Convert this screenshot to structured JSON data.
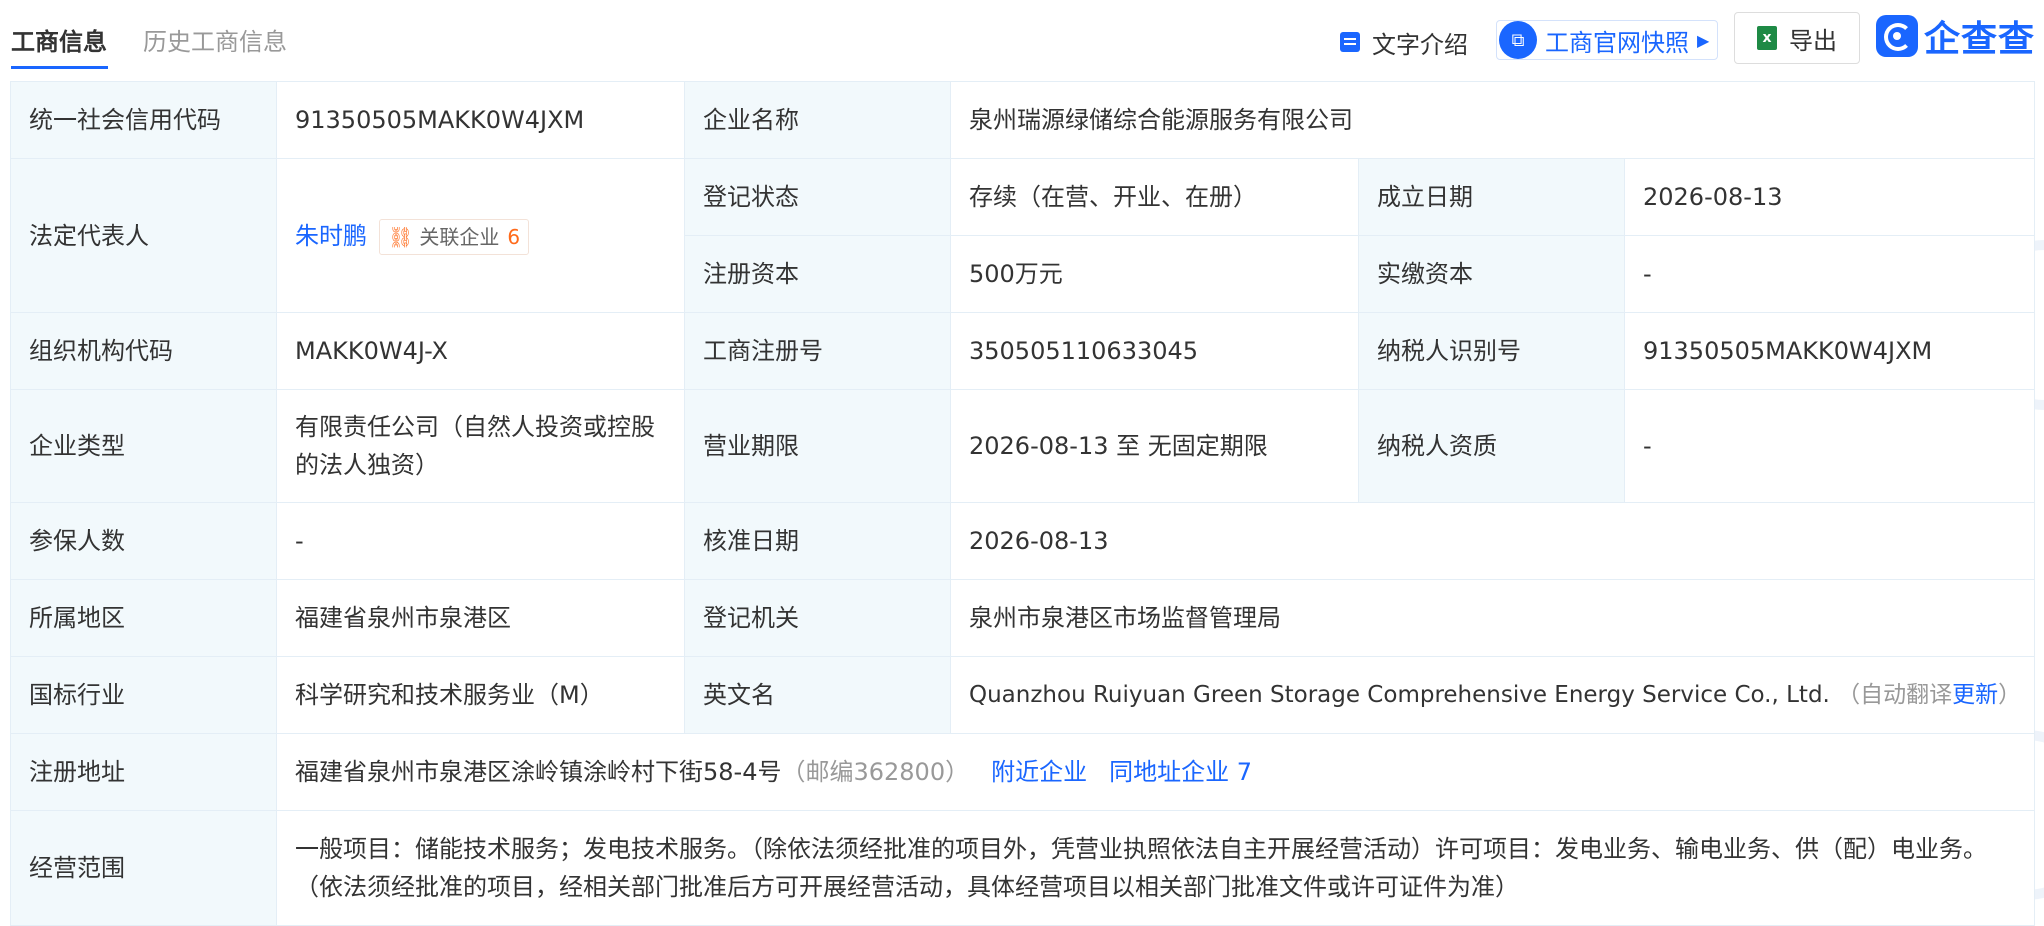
{
  "tabs": {
    "active": "工商信息",
    "inactive": "历史工商信息"
  },
  "actions": {
    "text_intro": "文字介绍",
    "snapshot": "工商官网快照",
    "export": "导出"
  },
  "logo": {
    "text": "企查查"
  },
  "rows": {
    "credit_code": {
      "label": "统一社会信用代码",
      "value": "91350505MAKK0W4JXM"
    },
    "company_name": {
      "label": "企业名称",
      "value": "泉州瑞源绿储综合能源服务有限公司"
    },
    "legal_rep": {
      "label": "法定代表人",
      "name": "朱时鹏",
      "assoc_label": "关联企业",
      "assoc_count": "6"
    },
    "reg_status": {
      "label": "登记状态",
      "value": "存续（在营、开业、在册）"
    },
    "found_date": {
      "label": "成立日期",
      "value": "2026-08-13"
    },
    "reg_capital": {
      "label": "注册资本",
      "value": "500万元"
    },
    "paid_capital": {
      "label": "实缴资本",
      "value": "-"
    },
    "org_code": {
      "label": "组织机构代码",
      "value": "MAKK0W4J-X"
    },
    "reg_no": {
      "label": "工商注册号",
      "value": "350505110633045"
    },
    "taxpayer_id": {
      "label": "纳税人识别号",
      "value": "91350505MAKK0W4JXM"
    },
    "company_type": {
      "label": "企业类型",
      "value": "有限责任公司（自然人投资或控股的法人独资）"
    },
    "biz_term": {
      "label": "营业期限",
      "value": "2026-08-13 至 无固定期限"
    },
    "taxpayer_qual": {
      "label": "纳税人资质",
      "value": "-"
    },
    "insured": {
      "label": "参保人数",
      "value": "-"
    },
    "approval_date": {
      "label": "核准日期",
      "value": "2026-08-13"
    },
    "region": {
      "label": "所属地区",
      "value": "福建省泉州市泉港区"
    },
    "authority": {
      "label": "登记机关",
      "value": "泉州市泉港区市场监督管理局"
    },
    "industry": {
      "label": "国标行业",
      "value": "科学研究和技术服务业（M）"
    },
    "english_name": {
      "label": "英文名",
      "value": "Quanzhou Ruiyuan Green Storage Comprehensive Energy Service Co., Ltd.",
      "note_prefix": "（自动翻译",
      "update": "更新",
      "note_suffix": "）"
    },
    "address": {
      "label": "注册地址",
      "value": "福建省泉州市泉港区涂岭镇涂岭村下街58-4号",
      "postcode": "（邮编362800）",
      "nearby": "附近企业",
      "same_addr": "同地址企业",
      "same_addr_count": "7"
    },
    "scope": {
      "label": "经营范围",
      "value": "一般项目：储能技术服务；发电技术服务。（除依法须经批准的项目外，凭营业执照依法自主开展经营活动）许可项目：发电业务、输电业务、供（配）电业务。（依法须经批准的项目，经相关部门批准后方可开展经营活动，具体经营项目以相关部门批准文件或许可证件为准）"
    }
  }
}
